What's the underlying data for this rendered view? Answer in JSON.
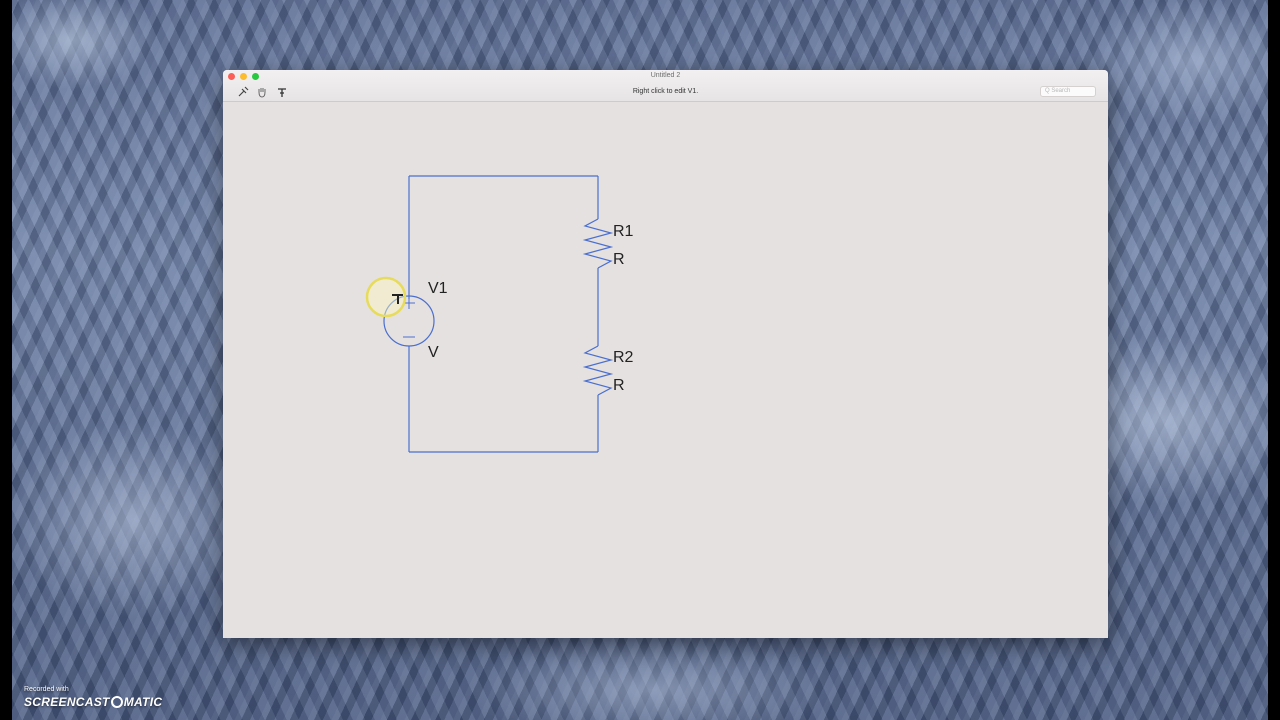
{
  "window": {
    "title": "Untitled 2",
    "status_text": "Right click to edit V1.",
    "search_placeholder": "Q Search"
  },
  "toolbar": {
    "tools": [
      "wire-tool-icon",
      "hand-tool-icon",
      "probe-tool-icon"
    ]
  },
  "circuit": {
    "source": {
      "name": "V1",
      "value": "V"
    },
    "resistors": [
      {
        "name": "R1",
        "value": "R"
      },
      {
        "name": "R2",
        "value": "R"
      }
    ],
    "wire_color": "#4a6fd0"
  },
  "watermark": {
    "line1": "Recorded with",
    "brand_left": "SCREENCAST",
    "brand_right": "MATIC"
  }
}
